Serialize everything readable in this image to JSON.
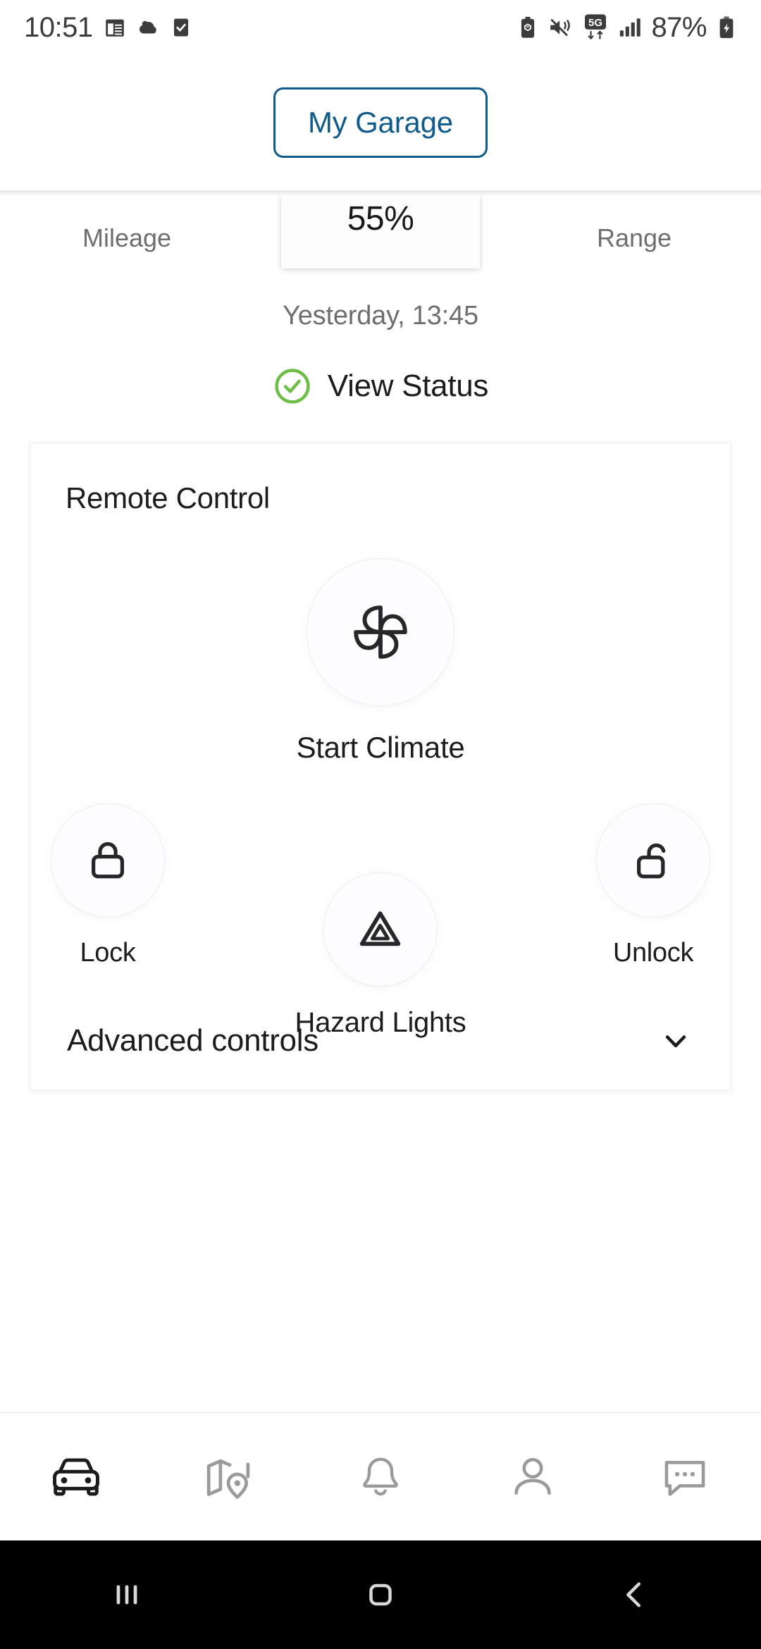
{
  "status_bar": {
    "time": "10:51",
    "battery_percent": "87%",
    "left_icons": [
      "calendar-icon",
      "weather-cloud-icon",
      "checkbox-checked-icon"
    ],
    "right_icons": [
      "battery-saver-icon",
      "vibrate-mute-icon",
      "5g-network-icon",
      "signal-bars-icon",
      "battery-charging-icon"
    ],
    "network_label": "5G",
    "text_color": "#3c3c3c"
  },
  "header": {
    "garage_button_label": "My Garage",
    "accent_color": "#0f5c8c"
  },
  "vehicle_stats": {
    "left": {
      "label": "Mileage"
    },
    "center": {
      "value": "55%"
    },
    "right": {
      "label": "Range"
    }
  },
  "status_section": {
    "timestamp": "Yesterday, 13:45",
    "view_status_label": "View Status",
    "check_icon_color": "#6cbe45"
  },
  "remote_control": {
    "title": "Remote Control",
    "climate": {
      "label": "Start Climate",
      "icon": "fan-pinwheel-icon"
    },
    "lock": {
      "label": "Lock",
      "icon": "lock-closed-icon"
    },
    "unlock": {
      "label": "Unlock",
      "icon": "lock-open-icon"
    },
    "hazard": {
      "label": "Hazard Lights",
      "icon": "hazard-triangle-icon"
    },
    "advanced": {
      "label": "Advanced controls",
      "icon": "chevron-down-icon"
    }
  },
  "bottom_nav": {
    "items": [
      {
        "name": "vehicle",
        "icon": "car-icon",
        "active": true
      },
      {
        "name": "map",
        "icon": "map-pin-icon",
        "active": false
      },
      {
        "name": "notifications",
        "icon": "bell-icon",
        "active": false
      },
      {
        "name": "profile",
        "icon": "person-icon",
        "active": false
      },
      {
        "name": "messages",
        "icon": "chat-bubble-icon",
        "active": false
      }
    ],
    "active_color": "#1c1c1c",
    "inactive_color": "#9a9a9a"
  },
  "system_nav": {
    "items": [
      "recents-button",
      "home-button",
      "back-button"
    ],
    "background": "#000000",
    "icon_color": "#d8d8d8"
  }
}
